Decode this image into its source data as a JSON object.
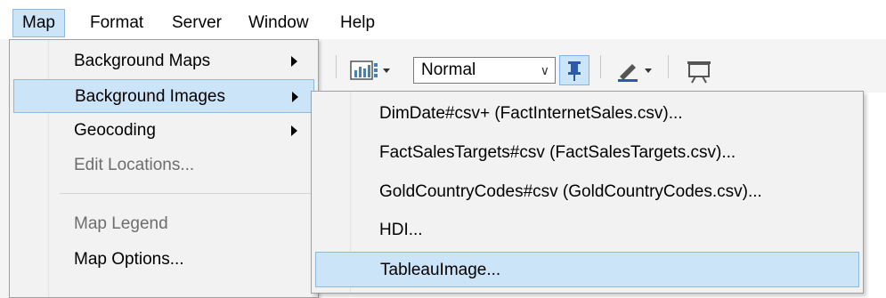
{
  "menubar": {
    "items": [
      {
        "label": "Map",
        "active": true
      },
      {
        "label": "Format",
        "active": false
      },
      {
        "label": "Server",
        "active": false
      },
      {
        "label": "Window",
        "active": false
      },
      {
        "label": "Help",
        "active": false
      }
    ]
  },
  "toolbar": {
    "mark_size_select_value": "Normal",
    "icons": [
      "chart-icon",
      "pin-icon",
      "pen-icon",
      "presentation-icon"
    ]
  },
  "map_menu": {
    "items": [
      {
        "label": "Background Maps",
        "has_submenu": true,
        "state": "normal"
      },
      {
        "label": "Background Images",
        "has_submenu": true,
        "state": "highlighted"
      },
      {
        "label": "Geocoding",
        "has_submenu": true,
        "state": "normal"
      },
      {
        "label": "Edit Locations...",
        "has_submenu": false,
        "state": "disabled"
      },
      {
        "label": "Map Legend",
        "has_submenu": false,
        "state": "disabled"
      },
      {
        "label": "Map Options...",
        "has_submenu": false,
        "state": "normal"
      }
    ]
  },
  "background_images_submenu": {
    "items": [
      {
        "label": "DimDate#csv+ (FactInternetSales.csv)...",
        "state": "normal"
      },
      {
        "label": "FactSalesTargets#csv (FactSalesTargets.csv)...",
        "state": "normal"
      },
      {
        "label": "GoldCountryCodes#csv (GoldCountryCodes.csv)...",
        "state": "normal"
      },
      {
        "label": "HDI...",
        "state": "normal"
      },
      {
        "label": "TableauImage...",
        "state": "highlighted"
      }
    ]
  },
  "colors": {
    "highlight": "#cce4f7",
    "highlight_border": "#8fb8db",
    "menu_bg": "#f2f2f2",
    "disabled_text": "#6d6d6d"
  }
}
